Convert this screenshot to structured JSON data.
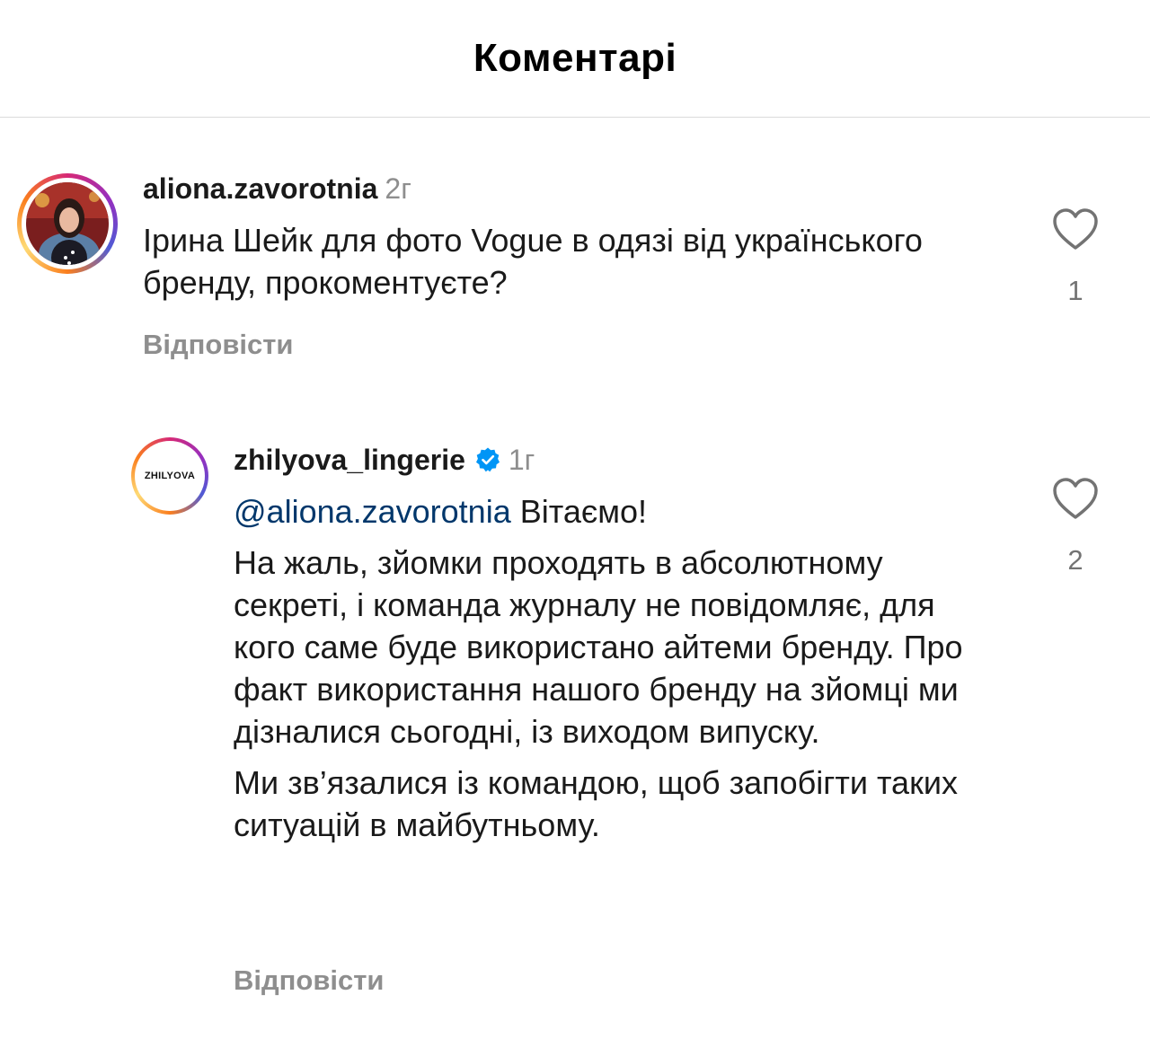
{
  "header": {
    "title": "Коментарі"
  },
  "comments": [
    {
      "username": "aliona.zavorotnia",
      "time": "2г",
      "text": "Ірина Шейк для фото Vogue в одязі від українського бренду, прокоментуєте?",
      "reply_label": "Відповісти",
      "like_count": "1"
    },
    {
      "username": "zhilyova_lingerie",
      "time": "1г",
      "verified": true,
      "avatar_logo": "ZHILYOVA",
      "mention": "@aliona.zavorotnia",
      "text_line1": "Вітаємо!",
      "text_para2": "На жаль, зйомки проходять в абсолютному секреті, і команда журналу не повідомляє, для кого саме буде використано айтеми бренду. Про факт використання нашого бренду на зйомці ми дізналися сьогодні, із виходом випуску.",
      "text_para3": "Ми зв’язалися із командою, щоб запобігти таких ситуацій в майбутньому.",
      "reply_label": "Відповісти",
      "like_count": "2"
    }
  ],
  "icons": {
    "like": "heart-outline-icon",
    "verified": "verified-badge-icon"
  },
  "colors": {
    "mention": "#00376b",
    "verified": "#0095f6",
    "muted": "#8e8e8e"
  }
}
